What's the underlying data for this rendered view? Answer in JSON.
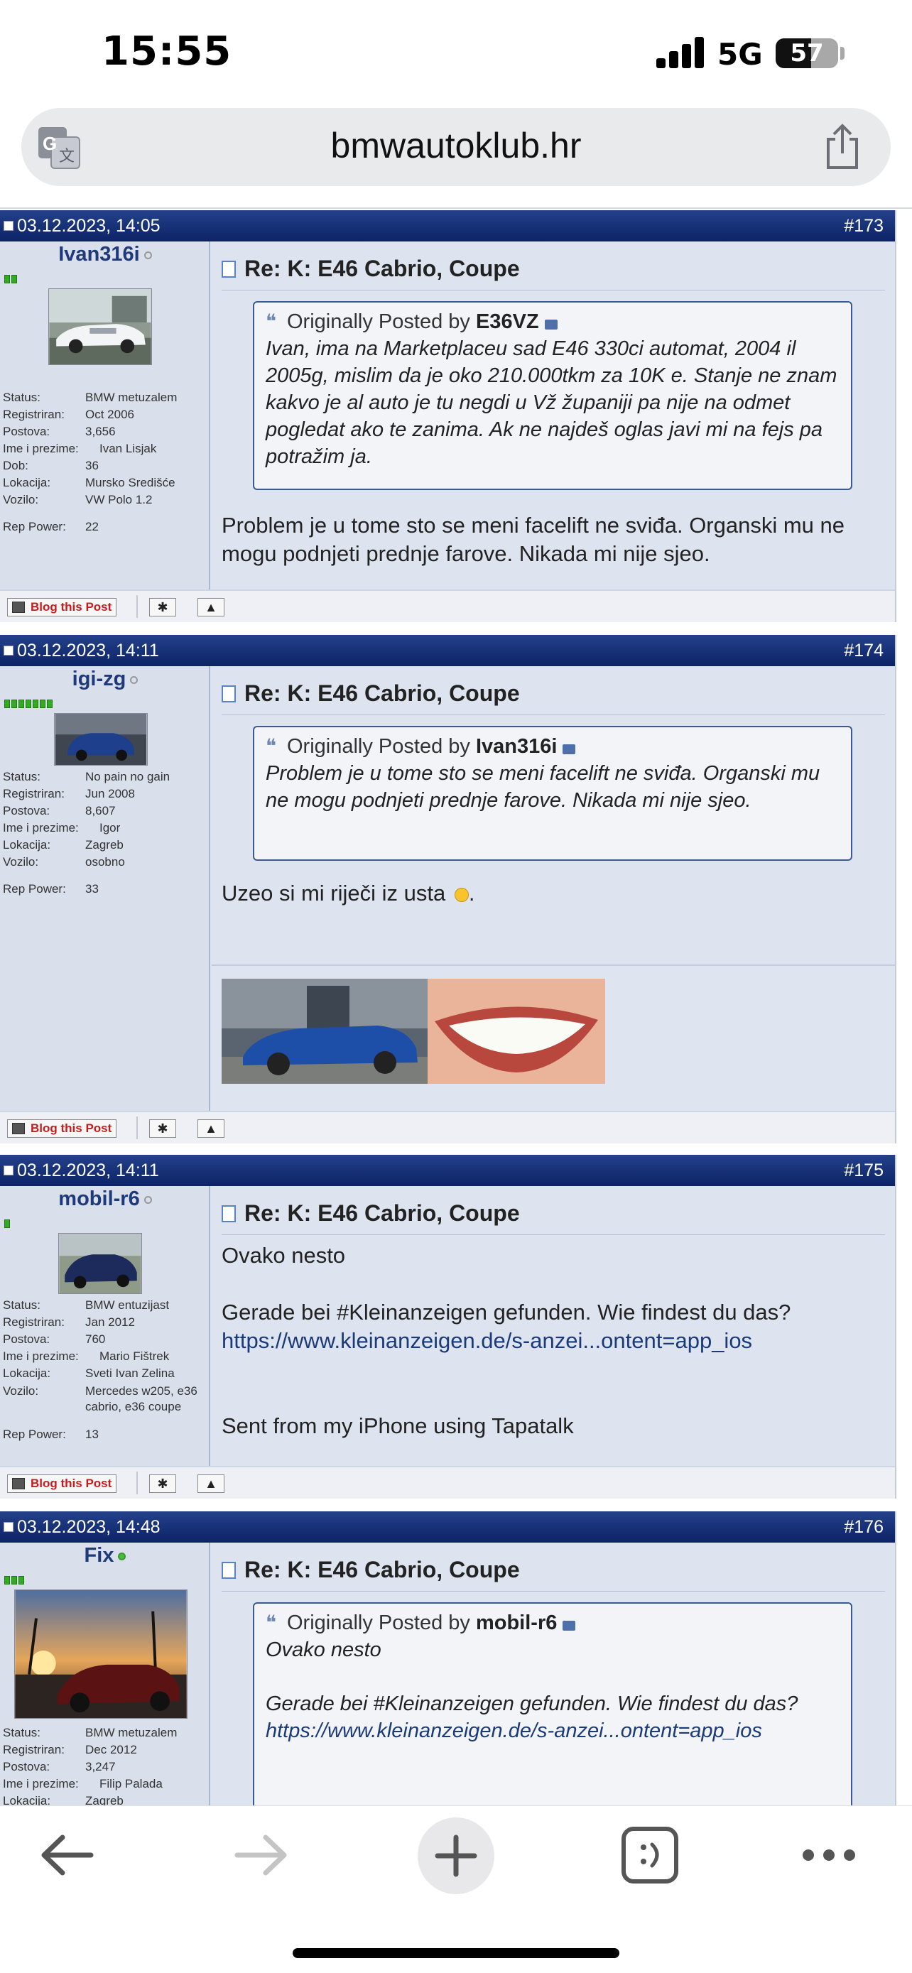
{
  "status_bar": {
    "time": "15:55",
    "network": "5G",
    "battery": "57",
    "battery_level": 0.57
  },
  "browser": {
    "domain": "bmwautoklub.hr"
  },
  "posts": [
    {
      "date": "03.12.2023, 14:05",
      "number": "#173",
      "username": "Ivan316i",
      "info": [
        {
          "k": "Status:",
          "v": "BMW metuzalem"
        },
        {
          "k": "Registriran:",
          "v": "Oct 2006"
        },
        {
          "k": "Postova:",
          "v": "3,656"
        },
        {
          "k": "Ime i prezime:",
          "v": "Ivan Lisjak"
        },
        {
          "k": "Dob:",
          "v": "36"
        },
        {
          "k": "Lokacija:",
          "v": "Mursko Središće"
        },
        {
          "k": "Vozilo:",
          "v": "VW Polo 1.2"
        },
        {
          "k": "Rep Power:",
          "v": "22"
        }
      ],
      "title": "Re: K: E46 Cabrio, Coupe",
      "quote": {
        "prefix": "Originally Posted by",
        "author": "E36VZ",
        "text": "Ivan, ima na Marketplaceu sad E46 330ci automat, 2004 il 2005g, mislim da je oko 210.000tkm za 10K e. Stanje ne znam kakvo je al auto je tu negdi u Vž županiji pa nije na odmet pogledat ako te zanima. Ak ne najdeš oglas javi mi na fejs pa potražim ja."
      },
      "message": "Problem je u tome sto se meni facelift ne sviđa. Organski mu ne mogu podnjeti prednje farove. Nikada mi nije sjeo.",
      "blog_label": "Blog this Post"
    },
    {
      "date": "03.12.2023, 14:11",
      "number": "#174",
      "username": "igi-zg",
      "info": [
        {
          "k": "Status:",
          "v": "No pain no gain"
        },
        {
          "k": "Registriran:",
          "v": "Jun 2008"
        },
        {
          "k": "Postova:",
          "v": "8,607"
        },
        {
          "k": "Ime i prezime:",
          "v": "Igor"
        },
        {
          "k": "Lokacija:",
          "v": "Zagreb"
        },
        {
          "k": "Vozilo:",
          "v": "osobno"
        },
        {
          "k": "Rep Power:",
          "v": "33"
        }
      ],
      "title": "Re: K: E46 Cabrio, Coupe",
      "quote": {
        "prefix": "Originally Posted by",
        "author": "Ivan316i",
        "text": "Problem je u tome sto se meni facelift ne sviđa. Organski mu ne mogu podnjeti prednje farove. Nikada mi nije sjeo."
      },
      "message": "Uzeo si mi riječi iz usta",
      "message_end": ".",
      "blog_label": "Blog this Post"
    },
    {
      "date": "03.12.2023, 14:11",
      "number": "#175",
      "username": "mobil-r6",
      "info": [
        {
          "k": "Status:",
          "v": "BMW entuzijast"
        },
        {
          "k": "Registriran:",
          "v": "Jan 2012"
        },
        {
          "k": "Postova:",
          "v": "760"
        },
        {
          "k": "Ime i prezime:",
          "v": "Mario Fištrek"
        },
        {
          "k": "Lokacija:",
          "v": "Sveti Ivan Zelina"
        },
        {
          "k": "Vozilo:",
          "v": "Mercedes w205, e36 cabrio, e36 coupe"
        },
        {
          "k": "Rep Power:",
          "v": "13"
        }
      ],
      "title": "Re: K: E46 Cabrio, Coupe",
      "message_line1": "Ovako nesto",
      "message_line2": "Gerade bei #Kleinanzeigen gefunden. Wie findest du das?",
      "link": "https://www.kleinanzeigen.de/s-anzei...ontent=app_ios",
      "message_line3": "Sent from my iPhone using Tapatalk",
      "blog_label": "Blog this Post"
    },
    {
      "date": "03.12.2023, 14:48",
      "number": "#176",
      "username": "Fix",
      "info": [
        {
          "k": "Status:",
          "v": "BMW metuzalem"
        },
        {
          "k": "Registriran:",
          "v": "Dec 2012"
        },
        {
          "k": "Postova:",
          "v": "3,247"
        },
        {
          "k": "Ime i prezime:",
          "v": "Filip Palada"
        },
        {
          "k": "Lokacija:",
          "v": "Zagreb"
        }
      ],
      "title": "Re: K: E46 Cabrio, Coupe",
      "quote": {
        "prefix": "Originally Posted by",
        "author": "mobil-r6",
        "line1": "Ovako nesto",
        "line2": "Gerade bei #Kleinanzeigen gefunden. Wie findest du das?",
        "link": "https://www.kleinanzeigen.de/s-anzei...ontent=app_ios"
      }
    }
  ],
  "icons": {
    "translate": "translate-icon",
    "share": "share-icon",
    "back": "back-arrow-icon",
    "forward": "forward-arrow-icon",
    "new_tab": "plus-icon",
    "tabs": "tabs-icon",
    "more": "more-icon",
    "star": "star-icon",
    "report": "warning-icon"
  },
  "colors": {
    "header": "#0d2366",
    "link": "#1a3a7a",
    "blog_red": "#c81c1c",
    "post_bg": "#dde3ef"
  }
}
